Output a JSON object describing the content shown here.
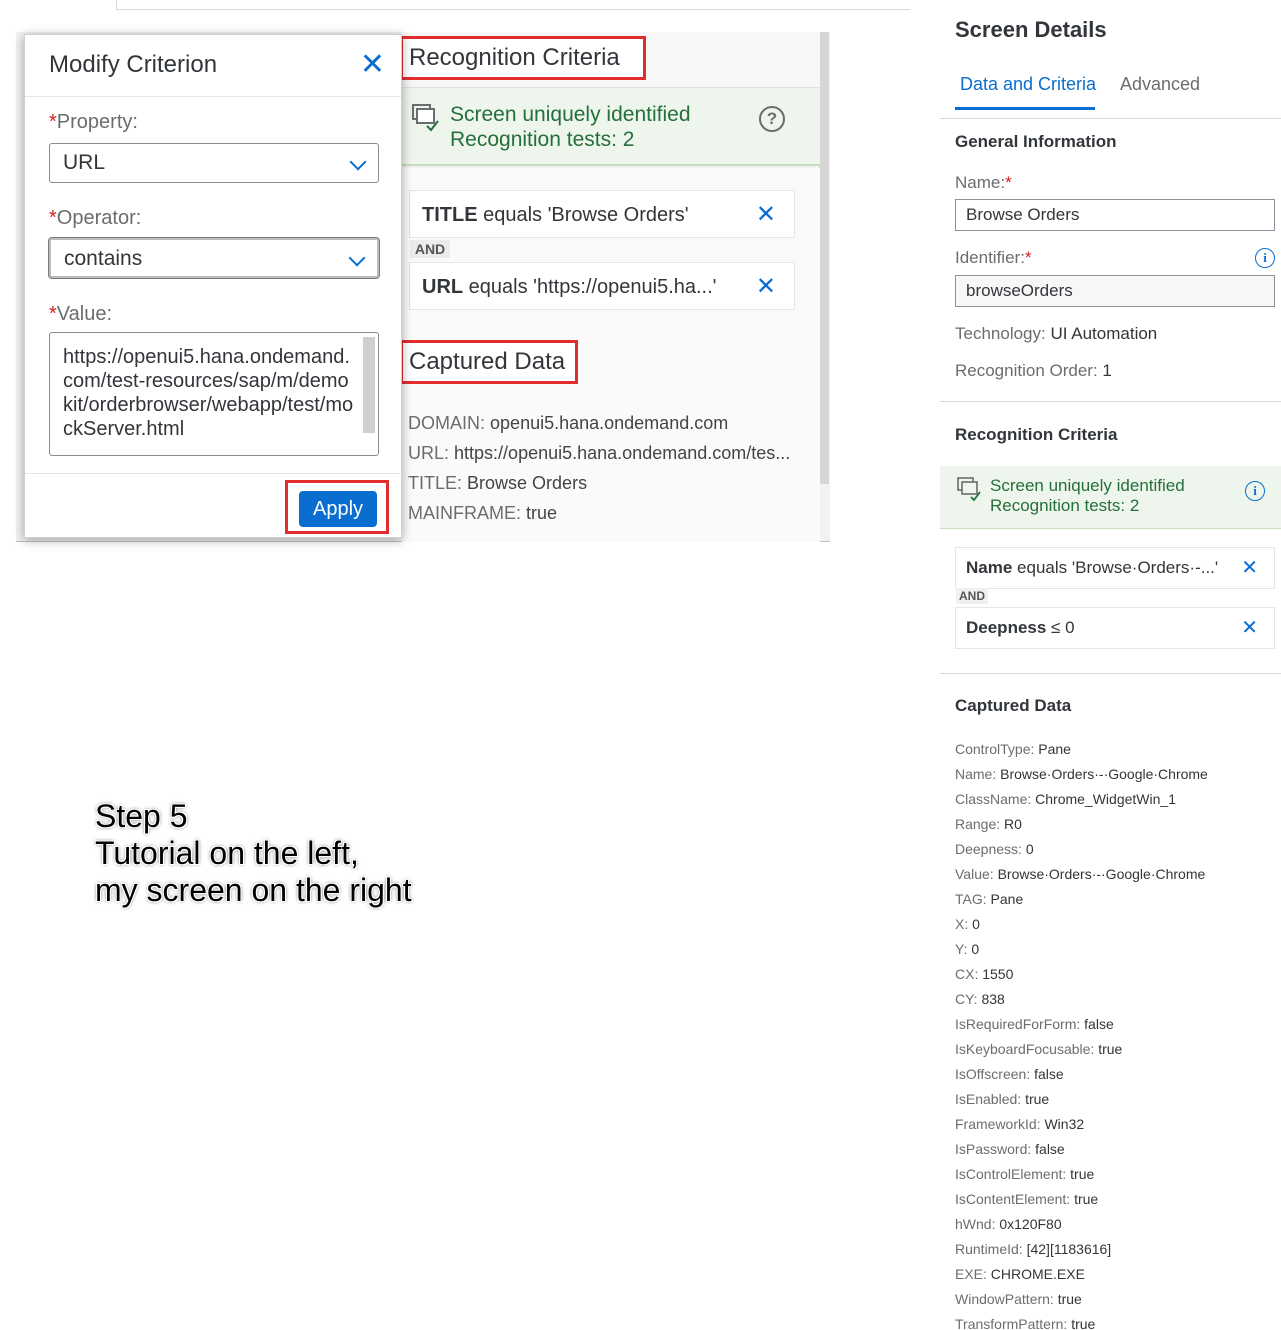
{
  "tutorial": {
    "dialog": {
      "title": "Modify Criterion",
      "property_label": "Property:",
      "property_value": "URL",
      "operator_label": "Operator:",
      "operator_value": "contains",
      "value_label": "Value:",
      "value_text": "https://openui5.hana.ondemand.com/test-resources/sap/m/demokit/orderbrowser/webapp/test/mockServer.html",
      "apply_label": "Apply",
      "required_mark": "*"
    },
    "recognition_title": "Recognition Criteria",
    "status_line1": "Screen uniquely identified",
    "status_line2": "Recognition tests: 2",
    "help_icon": "?",
    "criteria": [
      {
        "key": "TITLE",
        "rest": " equals 'Browse Orders'"
      },
      {
        "key": "URL",
        "rest": " equals 'https://openui5.ha...'"
      }
    ],
    "and_label": "AND",
    "captured_title": "Captured Data",
    "captured": [
      {
        "k": "DOMAIN:",
        "v": "openui5.hana.ondemand.com"
      },
      {
        "k": "URL:",
        "v": "https://openui5.hana.ondemand.com/tes..."
      },
      {
        "k": "TITLE:",
        "v": "Browse Orders"
      },
      {
        "k": "MAINFRAME:",
        "v": "true"
      }
    ]
  },
  "caption": {
    "line1": "Step 5",
    "line2": "Tutorial on the left,",
    "line3": "my screen on the right"
  },
  "panel": {
    "title": "Screen Details",
    "tabs": [
      "Data and Criteria",
      "Advanced"
    ],
    "general_title": "General Information",
    "name_label": "Name:",
    "name_value": "Browse Orders",
    "identifier_label": "Identifier:",
    "identifier_value": "browseOrders",
    "technology_label": "Technology:",
    "technology_value": "UI Automation",
    "order_label": "Recognition Order:",
    "order_value": "1",
    "required_mark": "*",
    "info_icon": "i",
    "recognition_title": "Recognition Criteria",
    "status_line1": "Screen uniquely identified",
    "status_line2": "Recognition tests: 2",
    "criteria": [
      {
        "key": "Name",
        "rest": " equals 'Browse·Orders·-...'"
      },
      {
        "key": "Deepness",
        "rest": " ≤ 0"
      }
    ],
    "and_label": "AND",
    "remove_icon": "✕",
    "captured_title": "Captured Data",
    "captured": [
      {
        "k": "ControlType:",
        "v": "Pane"
      },
      {
        "k": "Name:",
        "v": "Browse·Orders·-·Google·Chrome"
      },
      {
        "k": "ClassName:",
        "v": "Chrome_WidgetWin_1"
      },
      {
        "k": "Range:",
        "v": "R0"
      },
      {
        "k": "Deepness:",
        "v": "0"
      },
      {
        "k": "Value:",
        "v": "Browse·Orders·-·Google·Chrome"
      },
      {
        "k": "TAG:",
        "v": "Pane"
      },
      {
        "k": "X:",
        "v": "0"
      },
      {
        "k": "Y:",
        "v": "0"
      },
      {
        "k": "CX:",
        "v": "1550"
      },
      {
        "k": "CY:",
        "v": "838"
      },
      {
        "k": "IsRequiredForForm:",
        "v": "false"
      },
      {
        "k": "IsKeyboardFocusable:",
        "v": "true"
      },
      {
        "k": "IsOffscreen:",
        "v": "false"
      },
      {
        "k": "IsEnabled:",
        "v": "true"
      },
      {
        "k": "FrameworkId:",
        "v": "Win32"
      },
      {
        "k": "IsPassword:",
        "v": "false"
      },
      {
        "k": "IsControlElement:",
        "v": "true"
      },
      {
        "k": "IsContentElement:",
        "v": "true"
      },
      {
        "k": "hWnd:",
        "v": "0x120F80"
      },
      {
        "k": "RuntimeId:",
        "v": "[42][1183616]"
      },
      {
        "k": "EXE:",
        "v": "CHROME.EXE"
      },
      {
        "k": "WindowPattern:",
        "v": "true"
      },
      {
        "k": "TransformPattern:",
        "v": "true"
      }
    ]
  }
}
